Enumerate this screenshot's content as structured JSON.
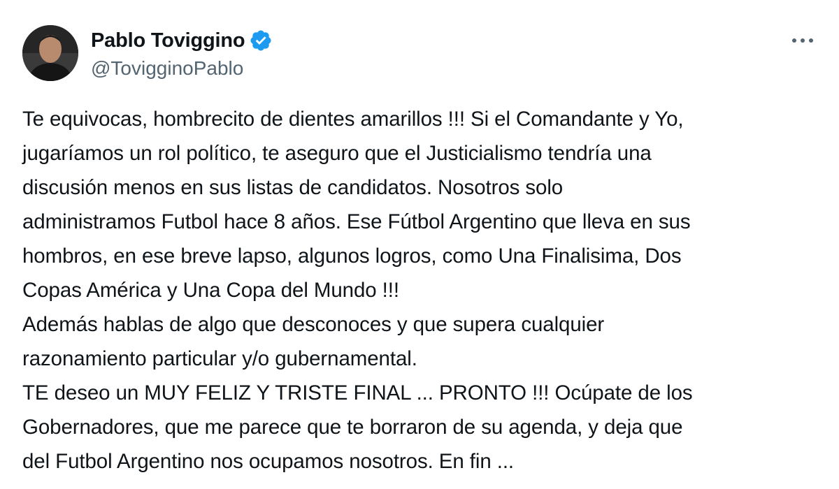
{
  "tweet": {
    "author": {
      "display_name": "Pablo Toviggino",
      "handle": "@TovigginoPablo",
      "verified": true,
      "verified_color": "#1d9bf0"
    },
    "menu_icon": "more-horizontal-icon",
    "text": "Te equivocas, hombrecito de dientes amarillos !!! Si el Comandante y Yo,\njugaríamos un rol político, te aseguro que el Justicialismo tendría una\ndiscusión menos en sus listas de candidatos. Nosotros solo\nadministramos Futbol hace 8 años. Ese Fútbol Argentino que lleva en sus\nhombros, en ese breve lapso, algunos logros, como Una Finalisima, Dos\nCopas América y Una Copa del Mundo !!!\nAdemás hablas de algo que desconoces y que supera cualquier\nrazonamiento particular y/o gubernamental.\nTE deseo un MUY FELIZ Y TRISTE FINAL ... PRONTO !!! Ocúpate de los\nGobernadores, que me parece que te borraron de su agenda, y deja que\ndel Futbol Argentino nos ocupamos nosotros. En fin ..."
  }
}
